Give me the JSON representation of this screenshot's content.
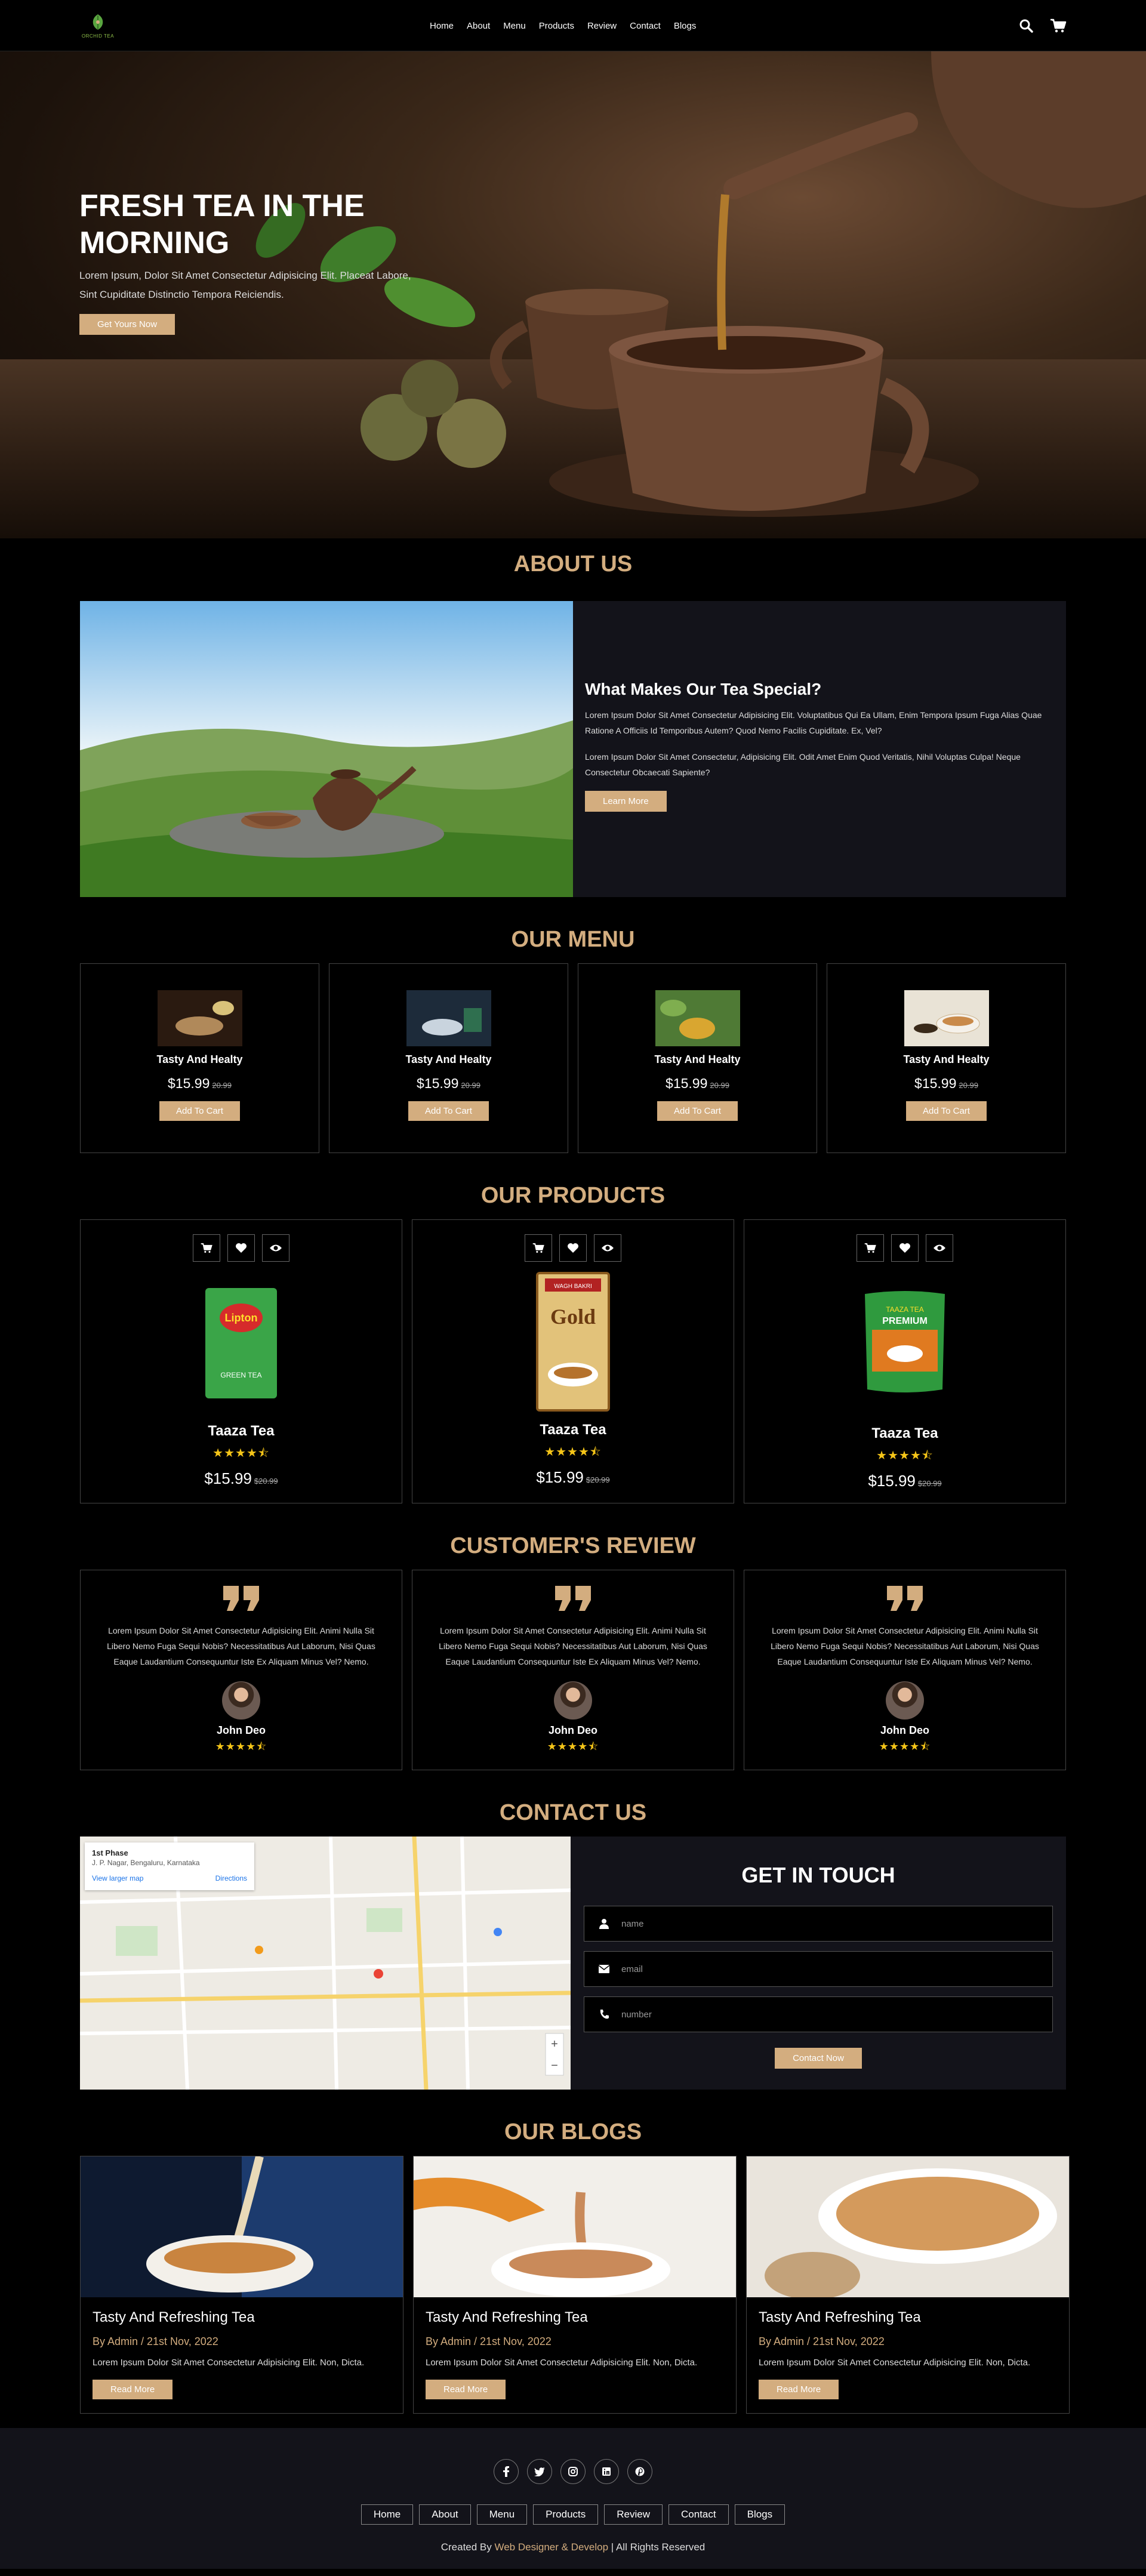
{
  "header": {
    "logo_text": "ORCHID TEA",
    "nav": [
      "Home",
      "About",
      "Menu",
      "Products",
      "Review",
      "Contact",
      "Blogs"
    ]
  },
  "hero": {
    "title": "FRESH TEA IN THE MORNING",
    "text": "Lorem Ipsum, Dolor Sit Amet Consectetur Adipisicing Elit. Placeat Labore, Sint Cupiditate Distinctio Tempora Reiciendis.",
    "button": "Get Yours Now"
  },
  "about": {
    "heading": "ABOUT US",
    "title": "What Makes Our Tea Special?",
    "p1": "Lorem Ipsum Dolor Sit Amet Consectetur Adipisicing Elit. Voluptatibus Qui Ea Ullam, Enim Tempora Ipsum Fuga Alias Quae Ratione A Officiis Id Temporibus Autem? Quod Nemo Facilis Cupiditate. Ex, Vel?",
    "p2": "Lorem Ipsum Dolor Sit Amet Consectetur, Adipisicing Elit. Odit Amet Enim Quod Veritatis, Nihil Voluptas Culpa! Neque Consectetur Obcaecati Sapiente?",
    "button": "Learn More"
  },
  "menu": {
    "heading": "OUR MENU",
    "items": [
      {
        "name": "Tasty And Healty",
        "price": "$15.99",
        "old": "20.99",
        "button": "Add To Cart"
      },
      {
        "name": "Tasty And Healty",
        "price": "$15.99",
        "old": "20.99",
        "button": "Add To Cart"
      },
      {
        "name": "Tasty And Healty",
        "price": "$15.99",
        "old": "20.99",
        "button": "Add To Cart"
      },
      {
        "name": "Tasty And Healty",
        "price": "$15.99",
        "old": "20.99",
        "button": "Add To Cart"
      }
    ]
  },
  "products": {
    "heading": "OUR PRODUCTS",
    "items": [
      {
        "name": "Taaza Tea",
        "price": "$15.99",
        "old": "$20.99",
        "stars": "★★★★⯪",
        "pack_label": "Lipton",
        "pack_sub": "GREEN TEA",
        "pack_color": "#3aa548"
      },
      {
        "name": "Taaza Tea",
        "price": "$15.99",
        "old": "$20.99",
        "stars": "★★★★⯪",
        "pack_label": "Gold",
        "pack_sub": "WAGH BAKRI",
        "pack_color": "#c49a3c"
      },
      {
        "name": "Taaza Tea",
        "price": "$15.99",
        "old": "$20.99",
        "stars": "★★★★⯪",
        "pack_label": "PREMIUM",
        "pack_sub": "TAAZA TEA",
        "pack_color": "#2f9a3e"
      }
    ]
  },
  "reviews": {
    "heading": "CUSTOMER'S REVIEW",
    "items": [
      {
        "text": "Lorem Ipsum Dolor Sit Amet Consectetur Adipisicing Elit. Animi Nulla Sit Libero Nemo Fuga Sequi Nobis? Necessitatibus Aut Laborum, Nisi Quas Eaque Laudantium Consequuntur Iste Ex Aliquam Minus Vel? Nemo.",
        "name": "John Deo",
        "stars": "★★★★⯪"
      },
      {
        "text": "Lorem Ipsum Dolor Sit Amet Consectetur Adipisicing Elit. Animi Nulla Sit Libero Nemo Fuga Sequi Nobis? Necessitatibus Aut Laborum, Nisi Quas Eaque Laudantium Consequuntur Iste Ex Aliquam Minus Vel? Nemo.",
        "name": "John Deo",
        "stars": "★★★★⯪"
      },
      {
        "text": "Lorem Ipsum Dolor Sit Amet Consectetur Adipisicing Elit. Animi Nulla Sit Libero Nemo Fuga Sequi Nobis? Necessitatibus Aut Laborum, Nisi Quas Eaque Laudantium Consequuntur Iste Ex Aliquam Minus Vel? Nemo.",
        "name": "John Deo",
        "stars": "★★★★⯪"
      }
    ]
  },
  "contact": {
    "heading": "CONTACT US",
    "map_place": "1st Phase",
    "map_address": "J. P. Nagar, Bengaluru, Karnataka",
    "map_directions": "Directions",
    "map_larger": "View larger map",
    "form_title": "GET IN TOUCH",
    "name_placeholder": "name",
    "email_placeholder": "email",
    "number_placeholder": "number",
    "button": "Contact Now"
  },
  "blogs": {
    "heading": "OUR BLOGS",
    "items": [
      {
        "title": "Tasty And Refreshing Tea",
        "meta": "By Admin / 21st Nov, 2022",
        "text": "Lorem Ipsum Dolor Sit Amet Consectetur Adipisicing Elit. Non, Dicta.",
        "button": "Read More"
      },
      {
        "title": "Tasty And Refreshing Tea",
        "meta": "By Admin / 21st Nov, 2022",
        "text": "Lorem Ipsum Dolor Sit Amet Consectetur Adipisicing Elit. Non, Dicta.",
        "button": "Read More"
      },
      {
        "title": "Tasty And Refreshing Tea",
        "meta": "By Admin / 21st Nov, 2022",
        "text": "Lorem Ipsum Dolor Sit Amet Consectetur Adipisicing Elit. Non, Dicta.",
        "button": "Read More"
      }
    ]
  },
  "footer": {
    "socials": [
      "facebook-icon",
      "twitter-icon",
      "instagram-icon",
      "linkedin-icon",
      "pinterest-icon"
    ],
    "links": [
      "Home",
      "About",
      "Menu",
      "Products",
      "Review",
      "Contact",
      "Blogs"
    ],
    "credit_prefix": "Created By ",
    "credit_name": "Web Designer & Develop",
    "credit_suffix": " | All Rights Reserved"
  },
  "colors": {
    "accent": "#d3ad7f",
    "background": "#000000",
    "panel": "#13131a",
    "star": "#f5c518"
  }
}
